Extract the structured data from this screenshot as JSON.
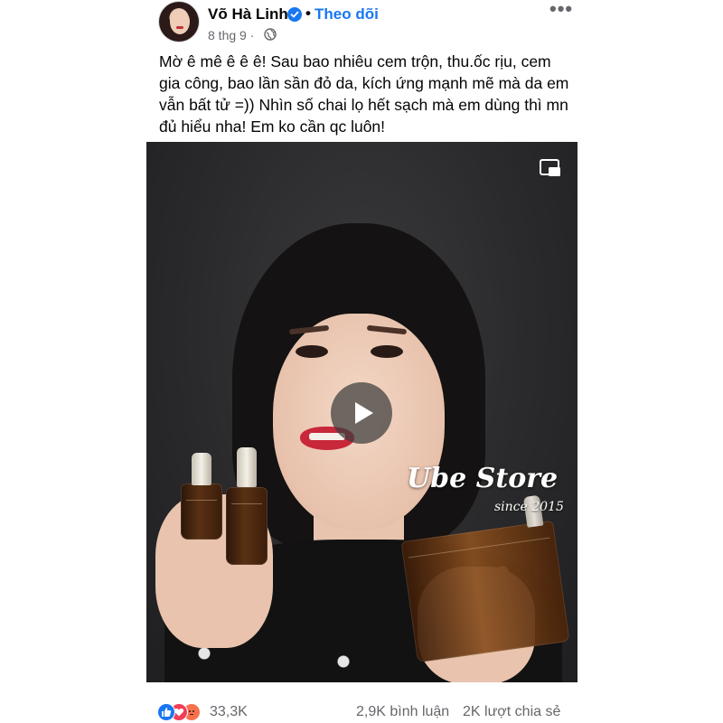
{
  "post": {
    "author": "Võ Hà Linh",
    "follow_label": "Theo dõi",
    "separator": "•",
    "time": "8 thg 9 ·",
    "audience_icon": "globe-icon",
    "more_icon": "more-options-icon",
    "caption": "Mờ ê mê ê ê ê! Sau bao nhiêu cem trộn, thu.ốc rịu, cem gia công, bao lần sần đỏ da, kích ứng mạnh mẽ mà da em vẫn bất tử =)) Nhìn số chai lọ hết sạch mà em dùng thì mn đủ hiểu nha! Em ko cần qc luôn!"
  },
  "video": {
    "watermark_title": "Ube Store",
    "watermark_subtitle": "since 2015",
    "play_icon": "play-icon",
    "pip_icon": "picture-in-picture-icon"
  },
  "footer": {
    "reactions": [
      "like",
      "love",
      "angry"
    ],
    "reaction_count": "33,3K",
    "comments": "2,9K bình luận",
    "shares": "2K lượt chia sẻ"
  },
  "colors": {
    "accent": "#1877f2",
    "text": "#050505",
    "muted": "#65676b"
  }
}
